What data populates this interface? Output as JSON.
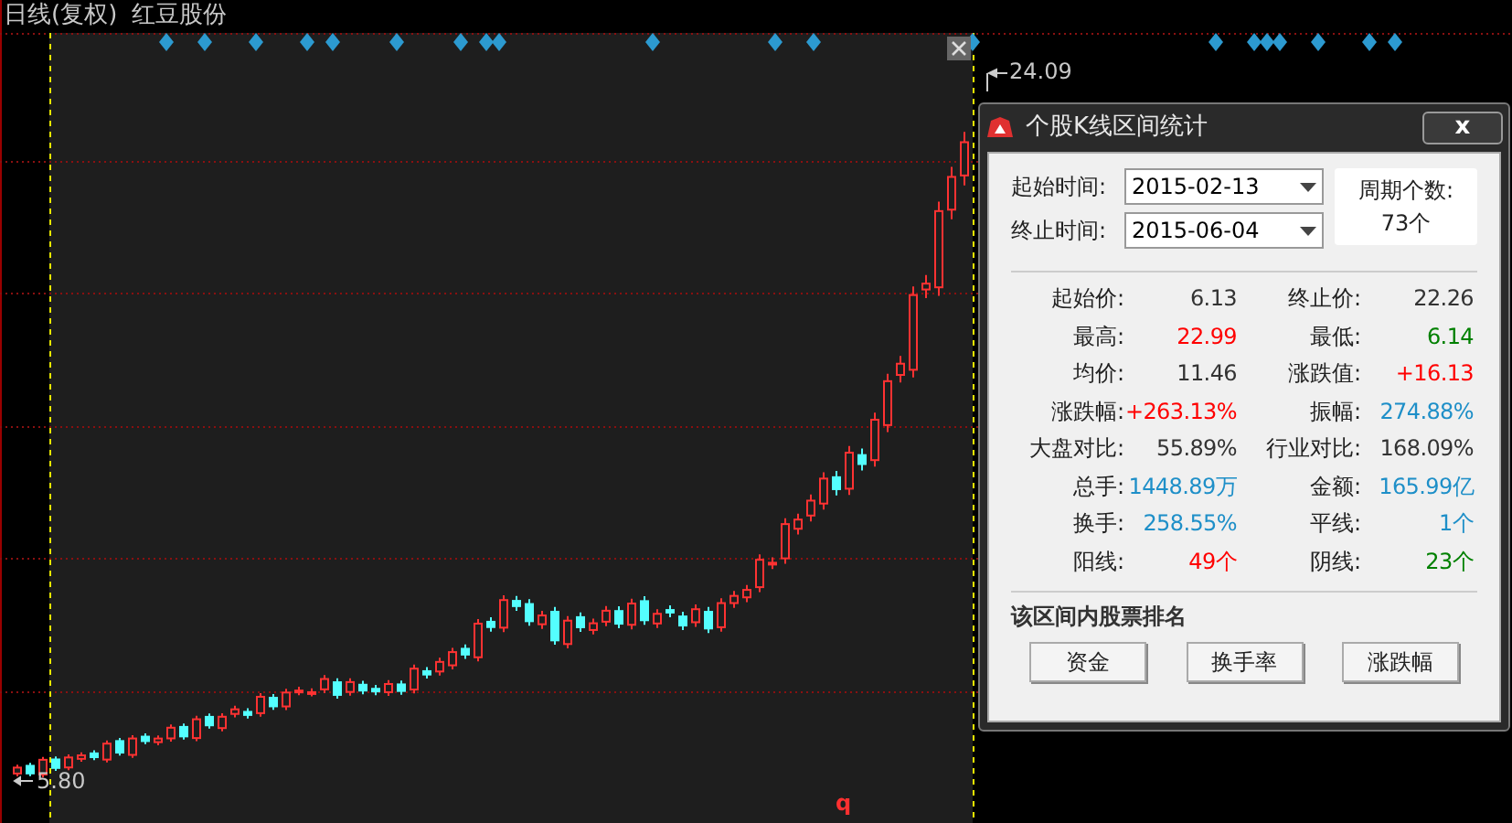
{
  "chart_header": {
    "period": "日线(复权)",
    "stock_name": "红豆股份"
  },
  "price_labels": {
    "high": "24.09",
    "low": "5.80"
  },
  "chart_marker": "q",
  "dialog": {
    "title": "个股K线区间统计",
    "close_label": "x",
    "start": {
      "label": "起始时间:",
      "value": "2015-02-13"
    },
    "end": {
      "label": "终止时间:",
      "value": "2015-06-04"
    },
    "period_count": {
      "label": "周期个数:",
      "value": "73个"
    },
    "stats": [
      {
        "label": "起始价:",
        "value": "6.13",
        "color": "#333333"
      },
      {
        "label": "终止价:",
        "value": "22.26",
        "color": "#333333"
      },
      {
        "label": "最高:",
        "value": "22.99",
        "color": "#ff0000"
      },
      {
        "label": "最低:",
        "value": "6.14",
        "color": "#008000"
      },
      {
        "label": "均价:",
        "value": "11.46",
        "color": "#333333"
      },
      {
        "label": "涨跌值:",
        "value": "+16.13",
        "color": "#ff0000"
      },
      {
        "label": "涨跌幅:",
        "value": "+263.13%",
        "color": "#ff0000"
      },
      {
        "label": "振幅:",
        "value": "274.88%",
        "color": "#1e8fc8"
      },
      {
        "label": "大盘对比:",
        "value": "55.89%",
        "color": "#333333"
      },
      {
        "label": "行业对比:",
        "value": "168.09%",
        "color": "#333333"
      },
      {
        "label": "总手:",
        "value": "1448.89万",
        "color": "#1e8fc8"
      },
      {
        "label": "金额:",
        "value": "165.99亿",
        "color": "#1e8fc8"
      },
      {
        "label": "换手:",
        "value": "258.55%",
        "color": "#1e8fc8"
      },
      {
        "label": "平线:",
        "value": "1个",
        "color": "#1e8fc8"
      },
      {
        "label": "阳线:",
        "value": "49个",
        "color": "#ff0000"
      },
      {
        "label": "阴线:",
        "value": "23个",
        "color": "#008000"
      }
    ],
    "ranking_title": "该区间内股票排名",
    "buttons": [
      "资金",
      "换手率",
      "涨跌幅"
    ]
  }
}
